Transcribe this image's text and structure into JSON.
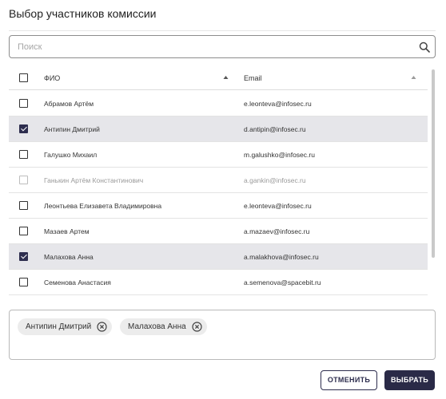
{
  "dialog": {
    "title": "Выбор участников комиссии"
  },
  "search": {
    "placeholder": "Поиск",
    "value": "",
    "icon": "search-icon"
  },
  "table": {
    "columns": {
      "name": "ФИО",
      "email": "Email"
    },
    "header_checked": false,
    "rows": [
      {
        "name": "Абрамов Артём",
        "email": "e.leonteva@infosec.ru",
        "checked": false,
        "disabled": false
      },
      {
        "name": "Антипин Дмитрий",
        "email": "d.antipin@infosec.ru",
        "checked": true,
        "disabled": false
      },
      {
        "name": "Галушко Михаил",
        "email": "m.galushko@infosec.ru",
        "checked": false,
        "disabled": false
      },
      {
        "name": "Ганькин Артём Константинович",
        "email": "a.gankin@infosec.ru",
        "checked": false,
        "disabled": true
      },
      {
        "name": "Леонтьева Елизавета Владимировна",
        "email": "e.leonteva@infosec.ru",
        "checked": false,
        "disabled": false
      },
      {
        "name": "Мазаев Артем",
        "email": "a.mazaev@infosec.ru",
        "checked": false,
        "disabled": false
      },
      {
        "name": "Малахова Анна",
        "email": "a.malakhova@infosec.ru",
        "checked": true,
        "disabled": false
      },
      {
        "name": "Семенова Анастасия",
        "email": "a.semenova@spacebit.ru",
        "checked": false,
        "disabled": false
      },
      {
        "name": "",
        "email": "",
        "checked": false,
        "disabled": false
      }
    ]
  },
  "selected": {
    "chips": [
      {
        "label": "Антипин Дмитрий"
      },
      {
        "label": "Малахова Анна"
      }
    ]
  },
  "actions": {
    "cancel_label": "ОТМЕНИТЬ",
    "submit_label": "ВЫБРАТЬ"
  },
  "colors": {
    "accent": "#2a2a47",
    "selected_row": "#e6e6ea",
    "chip_bg": "#ececec"
  }
}
